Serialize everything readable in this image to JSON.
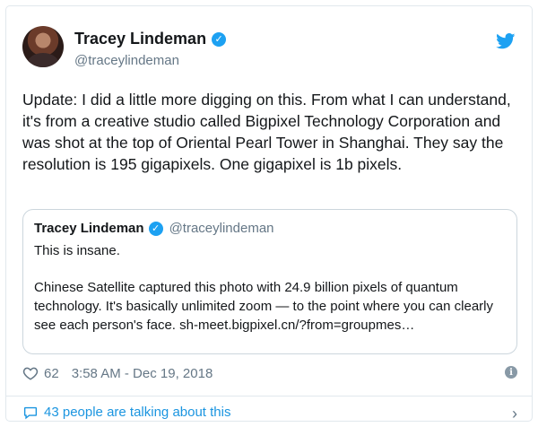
{
  "tweet": {
    "display_name": "Tracey Lindeman",
    "handle": "@traceylindeman",
    "text": "Update: I did a little more digging on this. From what I can understand, it's from a creative studio called Bigpixel Technology Corporation and was shot at the top of Oriental Pearl Tower in Shanghai. They say the resolution is 195 gigapixels. One gigapixel is 1b pixels.",
    "likes": "62",
    "timestamp": "3:58 AM - Dec 19, 2018"
  },
  "quoted": {
    "display_name": "Tracey Lindeman",
    "handle": "@traceylindeman",
    "line1": "This is insane.",
    "line2": "Chinese Satellite captured this photo with 24.9 billion pixels of quantum technology. It's basically unlimited zoom — to the point where you can clearly see each person's face.  sh-meet.bigpixel.cn/?from=groupmes…"
  },
  "footer": {
    "talking_text": "43 people are talking about this"
  },
  "colors": {
    "brand_blue": "#1da1f2",
    "link_blue": "#1b95e0",
    "muted": "#657786"
  },
  "icons": [
    "twitter-bird-icon",
    "verified-icon",
    "heart-icon",
    "info-icon",
    "comment-bubble-icon",
    "chevron-right-icon"
  ]
}
